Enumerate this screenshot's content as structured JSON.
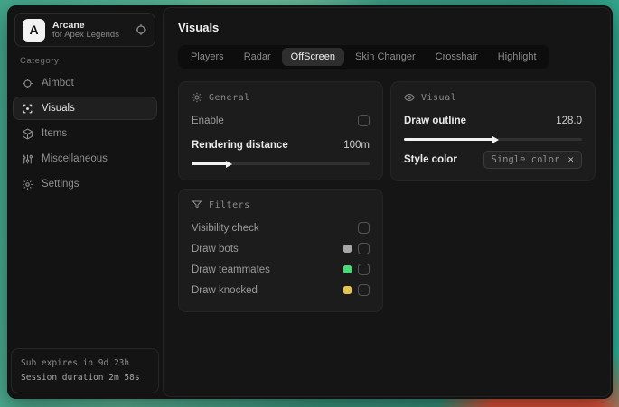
{
  "colors": {
    "accent_teal": "#3c9c83",
    "accent_orange": "#e2543a",
    "swatch_bots": "#a8a8a8",
    "swatch_teammates": "#4cd97b",
    "swatch_knocked": "#e3c351"
  },
  "sidebar": {
    "logo": {
      "monogram": "A",
      "title": "Arcane",
      "subtitle": "for Apex Legends"
    },
    "section_label": "Category",
    "items": [
      {
        "label": "Aimbot",
        "icon": "crosshair-icon",
        "active": false
      },
      {
        "label": "Visuals",
        "icon": "focus-icon",
        "active": true
      },
      {
        "label": "Items",
        "icon": "box-icon",
        "active": false
      },
      {
        "label": "Miscellaneous",
        "icon": "sliders-icon",
        "active": false
      },
      {
        "label": "Settings",
        "icon": "gear-icon",
        "active": false
      }
    ],
    "footer": {
      "sub_expires": "Sub expires in 9d 23h",
      "session_duration": "Session duration 2m 58s"
    }
  },
  "main": {
    "title": "Visuals",
    "tabs": [
      {
        "label": "Players",
        "active": false
      },
      {
        "label": "Radar",
        "active": false
      },
      {
        "label": "OffScreen",
        "active": true
      },
      {
        "label": "Skin Changer",
        "active": false
      },
      {
        "label": "Crosshair",
        "active": false
      },
      {
        "label": "Highlight",
        "active": false
      }
    ],
    "panels": {
      "general": {
        "header": "General",
        "icon": "sun-icon",
        "enable_label": "Enable",
        "enable_checked": false,
        "rendering": {
          "label": "Rendering distance",
          "value": "100m",
          "fill": "20%"
        }
      },
      "filters": {
        "header": "Filters",
        "icon": "funnel-icon",
        "visibility_label": "Visibility check",
        "visibility_checked": false,
        "rows": [
          {
            "label": "Draw bots",
            "swatch": "#a8a8a8",
            "checked": false
          },
          {
            "label": "Draw teammates",
            "swatch": "#4cd97b",
            "checked": false
          },
          {
            "label": "Draw knocked",
            "swatch": "#e3c351",
            "checked": false
          }
        ]
      },
      "visual": {
        "header": "Visual",
        "icon": "eye-icon",
        "outline": {
          "label": "Draw outline",
          "value": "128.0",
          "fill": "50%"
        },
        "style_color": {
          "label": "Style color",
          "selected": "Single color",
          "close_glyph": "×"
        }
      }
    }
  }
}
